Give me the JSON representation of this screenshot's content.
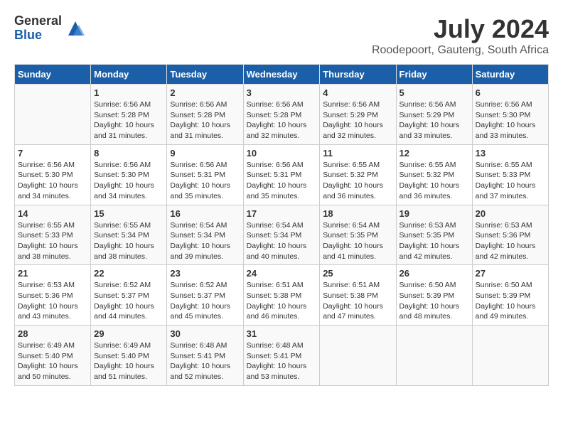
{
  "logo": {
    "general": "General",
    "blue": "Blue"
  },
  "title": "July 2024",
  "location": "Roodepoort, Gauteng, South Africa",
  "days_of_week": [
    "Sunday",
    "Monday",
    "Tuesday",
    "Wednesday",
    "Thursday",
    "Friday",
    "Saturday"
  ],
  "weeks": [
    [
      {
        "day": "",
        "sunrise": "",
        "sunset": "",
        "daylight": ""
      },
      {
        "day": "1",
        "sunrise": "Sunrise: 6:56 AM",
        "sunset": "Sunset: 5:28 PM",
        "daylight": "Daylight: 10 hours and 31 minutes."
      },
      {
        "day": "2",
        "sunrise": "Sunrise: 6:56 AM",
        "sunset": "Sunset: 5:28 PM",
        "daylight": "Daylight: 10 hours and 31 minutes."
      },
      {
        "day": "3",
        "sunrise": "Sunrise: 6:56 AM",
        "sunset": "Sunset: 5:28 PM",
        "daylight": "Daylight: 10 hours and 32 minutes."
      },
      {
        "day": "4",
        "sunrise": "Sunrise: 6:56 AM",
        "sunset": "Sunset: 5:29 PM",
        "daylight": "Daylight: 10 hours and 32 minutes."
      },
      {
        "day": "5",
        "sunrise": "Sunrise: 6:56 AM",
        "sunset": "Sunset: 5:29 PM",
        "daylight": "Daylight: 10 hours and 33 minutes."
      },
      {
        "day": "6",
        "sunrise": "Sunrise: 6:56 AM",
        "sunset": "Sunset: 5:30 PM",
        "daylight": "Daylight: 10 hours and 33 minutes."
      }
    ],
    [
      {
        "day": "7",
        "sunrise": "Sunrise: 6:56 AM",
        "sunset": "Sunset: 5:30 PM",
        "daylight": "Daylight: 10 hours and 34 minutes."
      },
      {
        "day": "8",
        "sunrise": "Sunrise: 6:56 AM",
        "sunset": "Sunset: 5:30 PM",
        "daylight": "Daylight: 10 hours and 34 minutes."
      },
      {
        "day": "9",
        "sunrise": "Sunrise: 6:56 AM",
        "sunset": "Sunset: 5:31 PM",
        "daylight": "Daylight: 10 hours and 35 minutes."
      },
      {
        "day": "10",
        "sunrise": "Sunrise: 6:56 AM",
        "sunset": "Sunset: 5:31 PM",
        "daylight": "Daylight: 10 hours and 35 minutes."
      },
      {
        "day": "11",
        "sunrise": "Sunrise: 6:55 AM",
        "sunset": "Sunset: 5:32 PM",
        "daylight": "Daylight: 10 hours and 36 minutes."
      },
      {
        "day": "12",
        "sunrise": "Sunrise: 6:55 AM",
        "sunset": "Sunset: 5:32 PM",
        "daylight": "Daylight: 10 hours and 36 minutes."
      },
      {
        "day": "13",
        "sunrise": "Sunrise: 6:55 AM",
        "sunset": "Sunset: 5:33 PM",
        "daylight": "Daylight: 10 hours and 37 minutes."
      }
    ],
    [
      {
        "day": "14",
        "sunrise": "Sunrise: 6:55 AM",
        "sunset": "Sunset: 5:33 PM",
        "daylight": "Daylight: 10 hours and 38 minutes."
      },
      {
        "day": "15",
        "sunrise": "Sunrise: 6:55 AM",
        "sunset": "Sunset: 5:34 PM",
        "daylight": "Daylight: 10 hours and 38 minutes."
      },
      {
        "day": "16",
        "sunrise": "Sunrise: 6:54 AM",
        "sunset": "Sunset: 5:34 PM",
        "daylight": "Daylight: 10 hours and 39 minutes."
      },
      {
        "day": "17",
        "sunrise": "Sunrise: 6:54 AM",
        "sunset": "Sunset: 5:34 PM",
        "daylight": "Daylight: 10 hours and 40 minutes."
      },
      {
        "day": "18",
        "sunrise": "Sunrise: 6:54 AM",
        "sunset": "Sunset: 5:35 PM",
        "daylight": "Daylight: 10 hours and 41 minutes."
      },
      {
        "day": "19",
        "sunrise": "Sunrise: 6:53 AM",
        "sunset": "Sunset: 5:35 PM",
        "daylight": "Daylight: 10 hours and 42 minutes."
      },
      {
        "day": "20",
        "sunrise": "Sunrise: 6:53 AM",
        "sunset": "Sunset: 5:36 PM",
        "daylight": "Daylight: 10 hours and 42 minutes."
      }
    ],
    [
      {
        "day": "21",
        "sunrise": "Sunrise: 6:53 AM",
        "sunset": "Sunset: 5:36 PM",
        "daylight": "Daylight: 10 hours and 43 minutes."
      },
      {
        "day": "22",
        "sunrise": "Sunrise: 6:52 AM",
        "sunset": "Sunset: 5:37 PM",
        "daylight": "Daylight: 10 hours and 44 minutes."
      },
      {
        "day": "23",
        "sunrise": "Sunrise: 6:52 AM",
        "sunset": "Sunset: 5:37 PM",
        "daylight": "Daylight: 10 hours and 45 minutes."
      },
      {
        "day": "24",
        "sunrise": "Sunrise: 6:51 AM",
        "sunset": "Sunset: 5:38 PM",
        "daylight": "Daylight: 10 hours and 46 minutes."
      },
      {
        "day": "25",
        "sunrise": "Sunrise: 6:51 AM",
        "sunset": "Sunset: 5:38 PM",
        "daylight": "Daylight: 10 hours and 47 minutes."
      },
      {
        "day": "26",
        "sunrise": "Sunrise: 6:50 AM",
        "sunset": "Sunset: 5:39 PM",
        "daylight": "Daylight: 10 hours and 48 minutes."
      },
      {
        "day": "27",
        "sunrise": "Sunrise: 6:50 AM",
        "sunset": "Sunset: 5:39 PM",
        "daylight": "Daylight: 10 hours and 49 minutes."
      }
    ],
    [
      {
        "day": "28",
        "sunrise": "Sunrise: 6:49 AM",
        "sunset": "Sunset: 5:40 PM",
        "daylight": "Daylight: 10 hours and 50 minutes."
      },
      {
        "day": "29",
        "sunrise": "Sunrise: 6:49 AM",
        "sunset": "Sunset: 5:40 PM",
        "daylight": "Daylight: 10 hours and 51 minutes."
      },
      {
        "day": "30",
        "sunrise": "Sunrise: 6:48 AM",
        "sunset": "Sunset: 5:41 PM",
        "daylight": "Daylight: 10 hours and 52 minutes."
      },
      {
        "day": "31",
        "sunrise": "Sunrise: 6:48 AM",
        "sunset": "Sunset: 5:41 PM",
        "daylight": "Daylight: 10 hours and 53 minutes."
      },
      {
        "day": "",
        "sunrise": "",
        "sunset": "",
        "daylight": ""
      },
      {
        "day": "",
        "sunrise": "",
        "sunset": "",
        "daylight": ""
      },
      {
        "day": "",
        "sunrise": "",
        "sunset": "",
        "daylight": ""
      }
    ]
  ]
}
